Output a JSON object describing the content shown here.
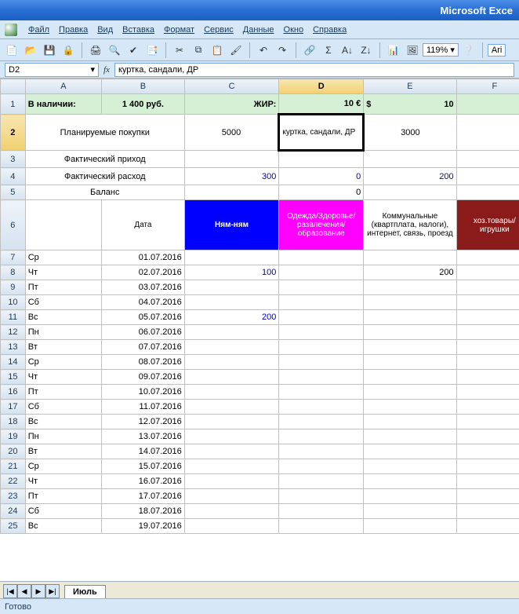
{
  "app": {
    "title": "Microsoft Exce"
  },
  "menu": {
    "file": "Файл",
    "edit": "Правка",
    "view": "Вид",
    "insert": "Вставка",
    "format": "Формат",
    "tools": "Сервис",
    "data": "Данные",
    "window": "Окно",
    "help": "Справка"
  },
  "toolbar": {
    "zoom": "119%",
    "font_partial": "Ari"
  },
  "namebox": {
    "ref": "D2"
  },
  "formula": {
    "value": "куртка, сандали, ДР"
  },
  "columns": [
    "A",
    "B",
    "C",
    "D",
    "E",
    "F"
  ],
  "rowheaders": [
    "1",
    "2",
    "3",
    "4",
    "5",
    "6",
    "7",
    "8",
    "9",
    "10",
    "11",
    "12",
    "13",
    "14",
    "15",
    "16",
    "17",
    "18",
    "19",
    "20",
    "21",
    "22",
    "23",
    "24",
    "25"
  ],
  "row1": {
    "A": "В наличии:",
    "B": "1 400 руб.",
    "C": "ЖИР:",
    "D": "10 €",
    "E_prefix": "$",
    "E_val": "10"
  },
  "row2": {
    "AB": "Планируемые покупки",
    "C": "5000",
    "D": "куртка, сандали, ДР",
    "E": "3000"
  },
  "row3": {
    "AB": "Фактический приход"
  },
  "row4": {
    "AB": "Фактический расход",
    "C": "300",
    "D": "0",
    "E": "200"
  },
  "row5": {
    "AB": "Баланс",
    "D": "0"
  },
  "row6": {
    "B": "Дата",
    "C": "Ням-ням",
    "D": "Одежда/Здоровье/развлечения/образование",
    "E": "Коммунальные (квартплата, налоги), интернет, связь, проезд",
    "F": "хоз.товары/игрушки"
  },
  "data_rows": [
    {
      "n": "7",
      "day": "Ср",
      "date": "01.07.2016",
      "C": "",
      "E": ""
    },
    {
      "n": "8",
      "day": "Чт",
      "date": "02.07.2016",
      "C": "100",
      "E": "200"
    },
    {
      "n": "9",
      "day": "Пт",
      "date": "03.07.2016",
      "C": "",
      "E": ""
    },
    {
      "n": "10",
      "day": "Сб",
      "date": "04.07.2016",
      "C": "",
      "E": ""
    },
    {
      "n": "11",
      "day": "Вс",
      "date": "05.07.2016",
      "C": "200",
      "E": ""
    },
    {
      "n": "12",
      "day": "Пн",
      "date": "06.07.2016",
      "C": "",
      "E": ""
    },
    {
      "n": "13",
      "day": "Вт",
      "date": "07.07.2016",
      "C": "",
      "E": ""
    },
    {
      "n": "14",
      "day": "Ср",
      "date": "08.07.2016",
      "C": "",
      "E": ""
    },
    {
      "n": "15",
      "day": "Чт",
      "date": "09.07.2016",
      "C": "",
      "E": ""
    },
    {
      "n": "16",
      "day": "Пт",
      "date": "10.07.2016",
      "C": "",
      "E": ""
    },
    {
      "n": "17",
      "day": "Сб",
      "date": "11.07.2016",
      "C": "",
      "E": ""
    },
    {
      "n": "18",
      "day": "Вс",
      "date": "12.07.2016",
      "C": "",
      "E": ""
    },
    {
      "n": "19",
      "day": "Пн",
      "date": "13.07.2016",
      "C": "",
      "E": ""
    },
    {
      "n": "20",
      "day": "Вт",
      "date": "14.07.2016",
      "C": "",
      "E": ""
    },
    {
      "n": "21",
      "day": "Ср",
      "date": "15.07.2016",
      "C": "",
      "E": ""
    },
    {
      "n": "22",
      "day": "Чт",
      "date": "16.07.2016",
      "C": "",
      "E": ""
    },
    {
      "n": "23",
      "day": "Пт",
      "date": "17.07.2016",
      "C": "",
      "E": ""
    },
    {
      "n": "24",
      "day": "Сб",
      "date": "18.07.2016",
      "C": "",
      "E": ""
    },
    {
      "n": "25",
      "day": "Вс",
      "date": "19.07.2016",
      "C": "",
      "E": ""
    }
  ],
  "tabs": {
    "active": "Июль"
  },
  "status": {
    "text": "Готово"
  }
}
